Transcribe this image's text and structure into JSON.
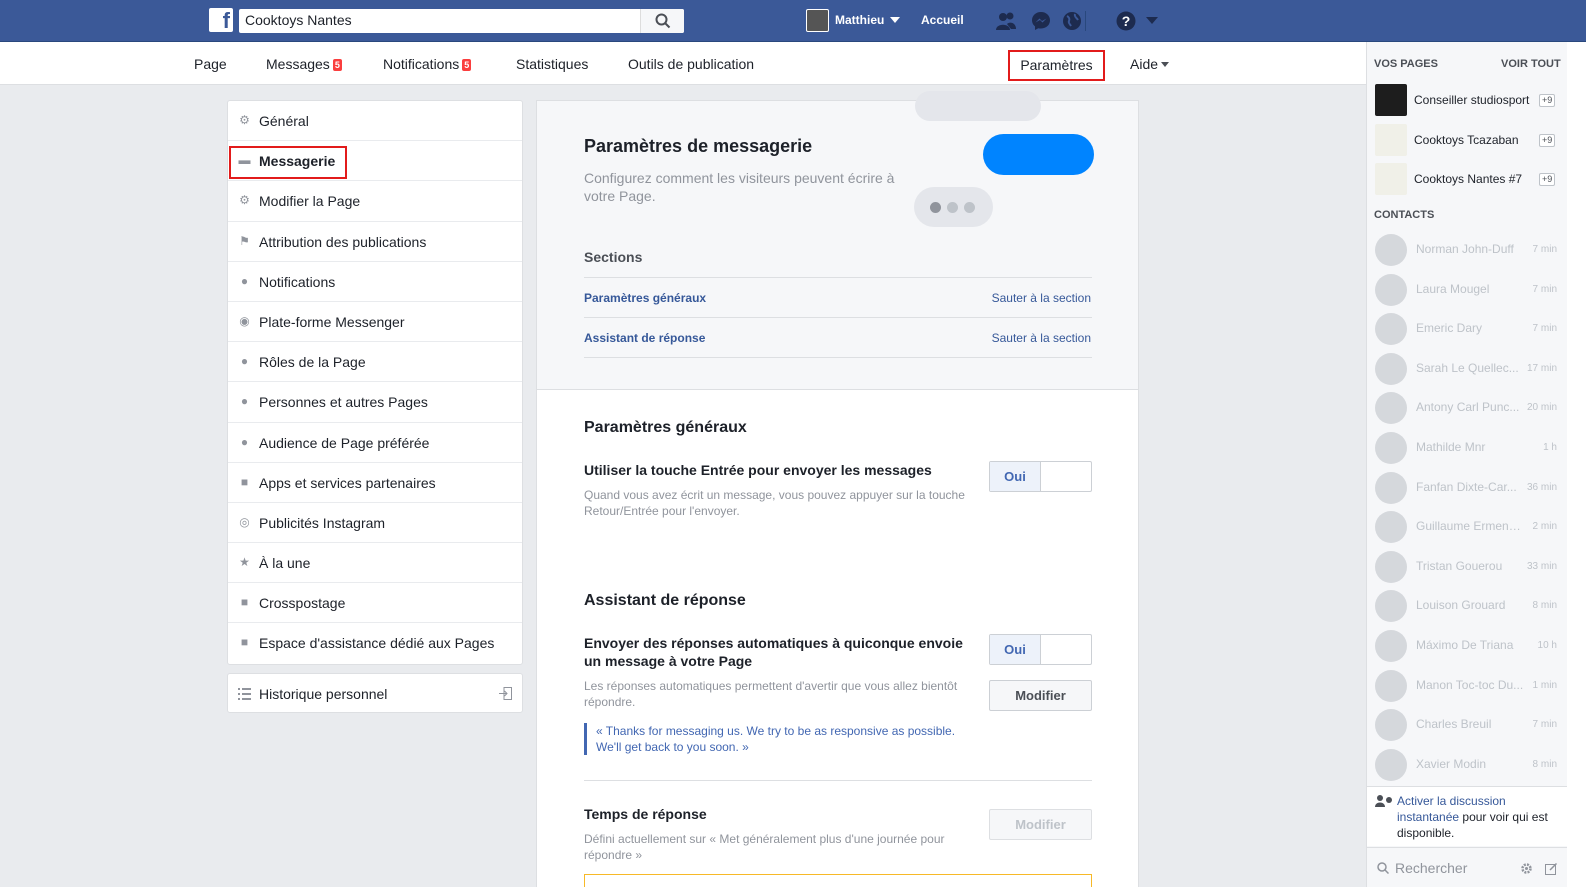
{
  "topbar": {
    "search_value": "Cooktoys Nantes",
    "user": "Matthieu",
    "home": "Accueil",
    "icons": [
      "friends-icon",
      "messenger-icon",
      "globe-icon",
      "help-icon"
    ]
  },
  "pagenav": {
    "page": "Page",
    "messages": "Messages",
    "messages_badge": "5",
    "notifications": "Notifications",
    "notifications_badge": "5",
    "stats": "Statistiques",
    "tools": "Outils de publication",
    "params": "Paramètres",
    "help": "Aide"
  },
  "leftmenu": {
    "items": [
      {
        "label": "Général",
        "icon": "gear-icon"
      },
      {
        "label": "Messagerie",
        "icon": "chat-icon"
      },
      {
        "label": "Modifier la Page",
        "icon": "gear-icon"
      },
      {
        "label": "Attribution des publications",
        "icon": "flag-icon"
      },
      {
        "label": "Notifications",
        "icon": "globe-icon"
      },
      {
        "label": "Plate-forme Messenger",
        "icon": "messenger-icon"
      },
      {
        "label": "Rôles de la Page",
        "icon": "person-icon"
      },
      {
        "label": "Personnes et autres Pages",
        "icon": "person-add-icon"
      },
      {
        "label": "Audience de Page préférée",
        "icon": "person-add-icon"
      },
      {
        "label": "Apps et services partenaires",
        "icon": "box-icon"
      },
      {
        "label": "Publicités Instagram",
        "icon": "instagram-icon"
      },
      {
        "label": "À la une",
        "icon": "star-icon"
      },
      {
        "label": "Crosspostage",
        "icon": "video-icon"
      },
      {
        "label": "Espace d'assistance dédié aux Pages",
        "icon": "facebook-icon"
      }
    ],
    "history": "Historique personnel"
  },
  "main": {
    "title": "Paramètres de messagerie",
    "subtitle": "Configurez comment les visiteurs peuvent écrire à votre Page.",
    "sections_title": "Sections",
    "sections": [
      {
        "name": "Paramètres généraux",
        "jump": "Sauter à la section"
      },
      {
        "name": "Assistant de réponse",
        "jump": "Sauter à la section"
      }
    ],
    "general": {
      "title": "Paramètres généraux",
      "enter_label": "Utiliser la touche Entrée pour envoyer les messages",
      "enter_desc": "Quand vous avez écrit un message, vous pouvez appuyer sur la touche Retour/Entrée pour l'envoyer.",
      "enter_toggle": "Oui"
    },
    "assistant": {
      "title": "Assistant de réponse",
      "auto_label": "Envoyer des réponses automatiques à quiconque envoie un message à votre Page",
      "auto_desc": "Les réponses automatiques permettent d'avertir que vous allez bientôt répondre.",
      "auto_toggle": "Oui",
      "modify": "Modifier",
      "quote": "« Thanks for messaging us. We try to be as responsive as possible. We'll get back to you soon. »",
      "response_time_label": "Temps de réponse",
      "response_time_desc": "Défini actuellement sur « Met généralement plus d'une journée pour répondre »",
      "response_time_modify": "Modifier"
    }
  },
  "sidebar": {
    "your_pages": "VOS PAGES",
    "see_all": "VOIR TOUT",
    "pages": [
      {
        "name": "Conseiller studiosport",
        "count": "+9"
      },
      {
        "name": "Cooktoys Tcazaban",
        "count": "+9"
      },
      {
        "name": "Cooktoys Nantes #7",
        "count": "+9"
      }
    ],
    "contacts_title": "CONTACTS",
    "contacts": [
      {
        "name": "Norman John-Duff",
        "time": "7 min"
      },
      {
        "name": "Laura Mougel",
        "time": "7 min"
      },
      {
        "name": "Emeric Dary",
        "time": "7 min"
      },
      {
        "name": "Sarah Le Quellec...",
        "time": "17 min"
      },
      {
        "name": "Antony Carl Punc...",
        "time": "20 min"
      },
      {
        "name": "Mathilde Mnr",
        "time": "1 h"
      },
      {
        "name": "Fanfan Dixte-Car...",
        "time": "36 min"
      },
      {
        "name": "Guillaume Ermena...",
        "time": "2 min"
      },
      {
        "name": "Tristan Gouerou",
        "time": "33 min"
      },
      {
        "name": "Louison Grouard",
        "time": "8 min"
      },
      {
        "name": "Máximo De Triana",
        "time": "10 h"
      },
      {
        "name": "Manon Toc-toc Du...",
        "time": "1 min"
      },
      {
        "name": "Charles Breuil",
        "time": "7 min"
      },
      {
        "name": "Xavier Modin",
        "time": "8 min"
      }
    ],
    "activate_link": "Activer la discussion instantanée",
    "activate_rest": " pour voir qui est disponible.",
    "search_placeholder": "Rechercher"
  }
}
